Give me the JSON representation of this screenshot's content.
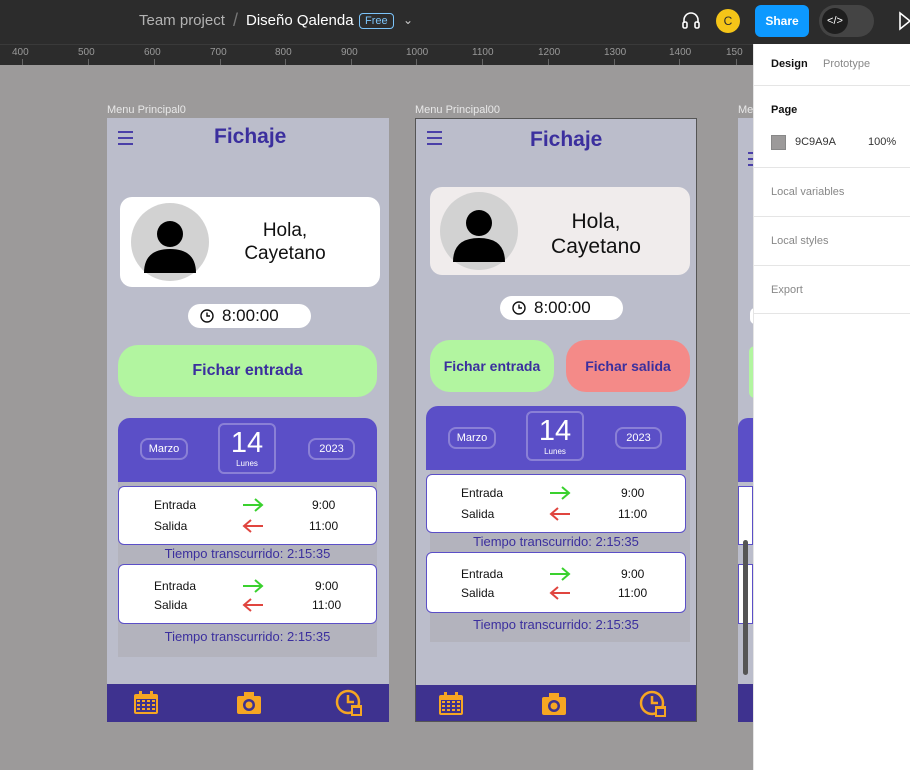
{
  "topbar": {
    "project": "Team project",
    "separator": "/",
    "file_name": "Diseño Qalenda",
    "plan_badge": "Free",
    "avatar_initial": "C",
    "share_label": "Share",
    "accent": "#0d99ff"
  },
  "ruler": {
    "labels": [
      "400",
      "500",
      "600",
      "700",
      "800",
      "900",
      "1000",
      "1100",
      "1200",
      "1300",
      "1400",
      "150"
    ]
  },
  "frames": [
    {
      "label": "Menu Principal0",
      "title": "Fichaje",
      "greeting_line1": "Hola,",
      "greeting_line2": "Cayetano",
      "time": "8:00:00",
      "btn_entrada": "Fichar entrada",
      "month": "Marzo",
      "day": "14",
      "weekday": "Lunes",
      "year": "2023",
      "entries": [
        {
          "in_label": "Entrada",
          "in_time": "9:00",
          "out_label": "Salida",
          "out_time": "11:00",
          "elapsed": "Tiempo transcurrido: 2:15:35"
        },
        {
          "in_label": "Entrada",
          "in_time": "9:00",
          "out_label": "Salida",
          "out_time": "11:00",
          "elapsed": "Tiempo transcurrido: 2:15:35"
        }
      ]
    },
    {
      "label": "Menu Principal00",
      "title": "Fichaje",
      "greeting_line1": "Hola,",
      "greeting_line2": "Cayetano",
      "time": "8:00:00",
      "btn_entrada": "Fichar entrada",
      "btn_salida": "Fichar salida",
      "month": "Marzo",
      "day": "14",
      "weekday": "Lunes",
      "year": "2023",
      "entries": [
        {
          "in_label": "Entrada",
          "in_time": "9:00",
          "out_label": "Salida",
          "out_time": "11:00",
          "elapsed": "Tiempo transcurrido: 2:15:35"
        },
        {
          "in_label": "Entrada",
          "in_time": "9:00",
          "out_label": "Salida",
          "out_time": "11:00",
          "elapsed": "Tiempo transcurrido: 2:15:35"
        }
      ]
    }
  ],
  "frame3_label": "Me",
  "colors": {
    "green_button": "#b2f5a0",
    "red_button": "#f48a88",
    "purple": "#5b4fc7",
    "nav": "#3e328f",
    "icon_yellow": "#f6a623",
    "arrow_in": "#3ad12e",
    "arrow_out": "#e0453f"
  },
  "right_panel": {
    "tab_design": "Design",
    "tab_prototype": "Prototype",
    "page_heading": "Page",
    "page_color": "9C9A9A",
    "page_opacity": "100%",
    "local_variables": "Local variables",
    "local_styles": "Local styles",
    "export": "Export"
  }
}
